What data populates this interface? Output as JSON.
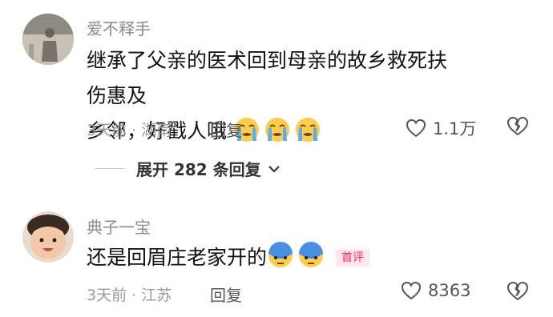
{
  "comments": [
    {
      "username": "爱不释手",
      "text_line1": "继承了父亲的医术回到母亲的故乡救死扶伤惠及",
      "text_line2": "乡邻，好戳人哦",
      "emoji": [
        "loudly-crying-face",
        "loudly-crying-face",
        "loudly-crying-face"
      ],
      "meta": "3天前 · 湖南",
      "reply_label": "回复",
      "like_count": "1.1万",
      "expand_label": "展开 282 条回复"
    },
    {
      "username": "典子一宝",
      "text": "还是回眉庄老家开的",
      "emoji": [
        "blue-face-emoji",
        "blue-face-emoji"
      ],
      "badge": "首评",
      "meta": "3天前 · 江苏",
      "reply_label": "回复",
      "like_count": "8363"
    }
  ],
  "colors": {
    "accent": "#fe2c55",
    "text": "#111111",
    "muted": "#9a9a9a"
  }
}
